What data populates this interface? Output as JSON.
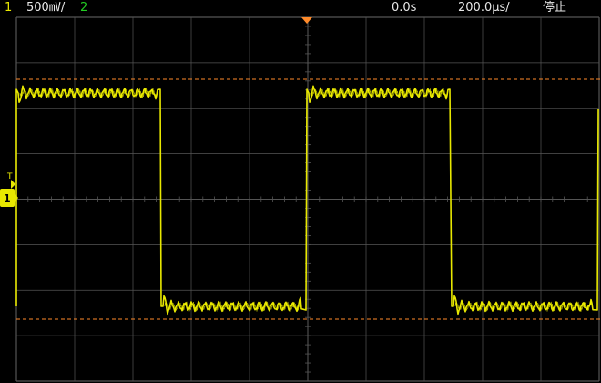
{
  "status_bar": {
    "channel1_label": "1",
    "channel1_scale": "500㎷/",
    "channel2_label": "2",
    "time_offset": "0.0s",
    "time_scale": "200.0μs/",
    "run_state": "停止"
  },
  "colors": {
    "channel1": "#e8e800",
    "channel2": "#22cc22",
    "grid": "#555555",
    "cursor": "#ff8a2a",
    "text": "#e8e8e8",
    "background": "#000000"
  },
  "markers": {
    "trigger_label": "T",
    "ground_label": "1"
  },
  "waveform": {
    "type": "square",
    "cycles_visible": 2,
    "duty_cycle": 0.5,
    "ringing_on_flat_sections": true
  },
  "cursors": {
    "upper_visible": true,
    "lower_visible": true
  }
}
